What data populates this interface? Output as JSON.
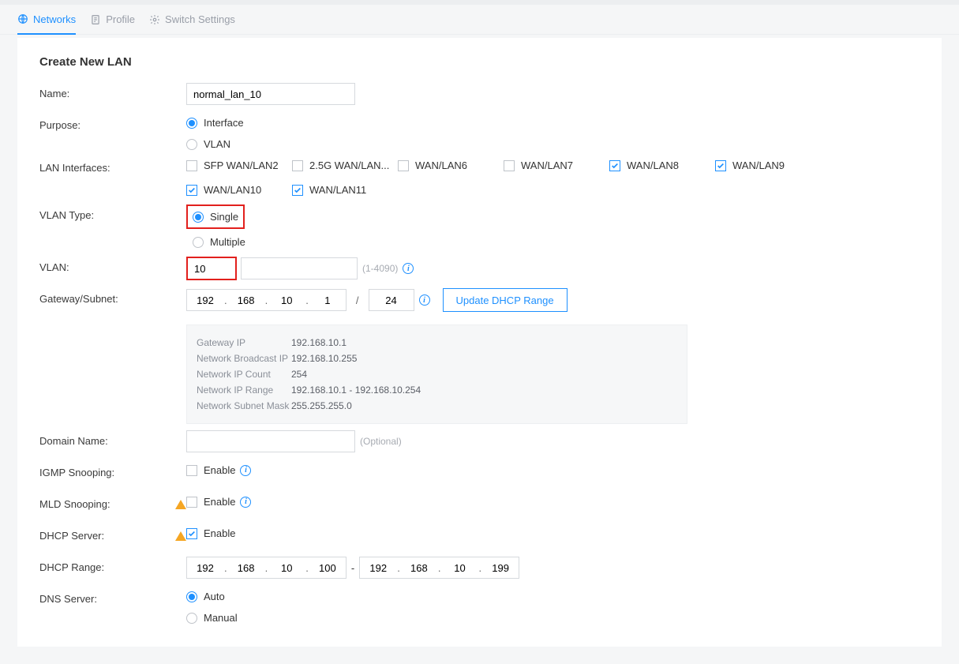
{
  "tabs": {
    "networks": "Networks",
    "profile": "Profile",
    "switch_settings": "Switch Settings"
  },
  "page_title": "Create New LAN",
  "labels": {
    "name": "Name:",
    "purpose": "Purpose:",
    "lan_interfaces": "LAN Interfaces:",
    "vlan_type": "VLAN Type:",
    "vlan": "VLAN:",
    "gateway_subnet": "Gateway/Subnet:",
    "domain_name": "Domain Name:",
    "igmp": "IGMP Snooping:",
    "mld": "MLD Snooping:",
    "dhcp_server": "DHCP Server:",
    "dhcp_range": "DHCP Range:",
    "dns_server": "DNS Server:"
  },
  "name_value": "normal_lan_10",
  "purpose": {
    "interface": "Interface",
    "vlan": "VLAN"
  },
  "lan_ifaces": [
    {
      "label": "SFP WAN/LAN2",
      "checked": false
    },
    {
      "label": "2.5G WAN/LAN...",
      "checked": false
    },
    {
      "label": "WAN/LAN6",
      "checked": false
    },
    {
      "label": "WAN/LAN7",
      "checked": false
    },
    {
      "label": "WAN/LAN8",
      "checked": true
    },
    {
      "label": "WAN/LAN9",
      "checked": true
    },
    {
      "label": "WAN/LAN10",
      "checked": true
    },
    {
      "label": "WAN/LAN11",
      "checked": true
    }
  ],
  "vlan_type": {
    "single": "Single",
    "multiple": "Multiple"
  },
  "vlan_value": "10",
  "vlan_hint": "(1-4090)",
  "gateway": {
    "o1": "192",
    "o2": "168",
    "o3": "10",
    "o4": "1",
    "mask": "24"
  },
  "update_btn": "Update DHCP Range",
  "netinfo": [
    {
      "k": "Gateway IP",
      "v": "192.168.10.1"
    },
    {
      "k": "Network Broadcast IP",
      "v": "192.168.10.255"
    },
    {
      "k": "Network IP Count",
      "v": "254"
    },
    {
      "k": "Network IP Range",
      "v": "192.168.10.1 - 192.168.10.254"
    },
    {
      "k": "Network Subnet Mask",
      "v": "255.255.255.0"
    }
  ],
  "domain_hint": "(Optional)",
  "enable_label": "Enable",
  "dhcp_range": {
    "start": {
      "o1": "192",
      "o2": "168",
      "o3": "10",
      "o4": "100"
    },
    "end": {
      "o1": "192",
      "o2": "168",
      "o3": "10",
      "o4": "199"
    }
  },
  "dns": {
    "auto": "Auto",
    "manual": "Manual"
  }
}
